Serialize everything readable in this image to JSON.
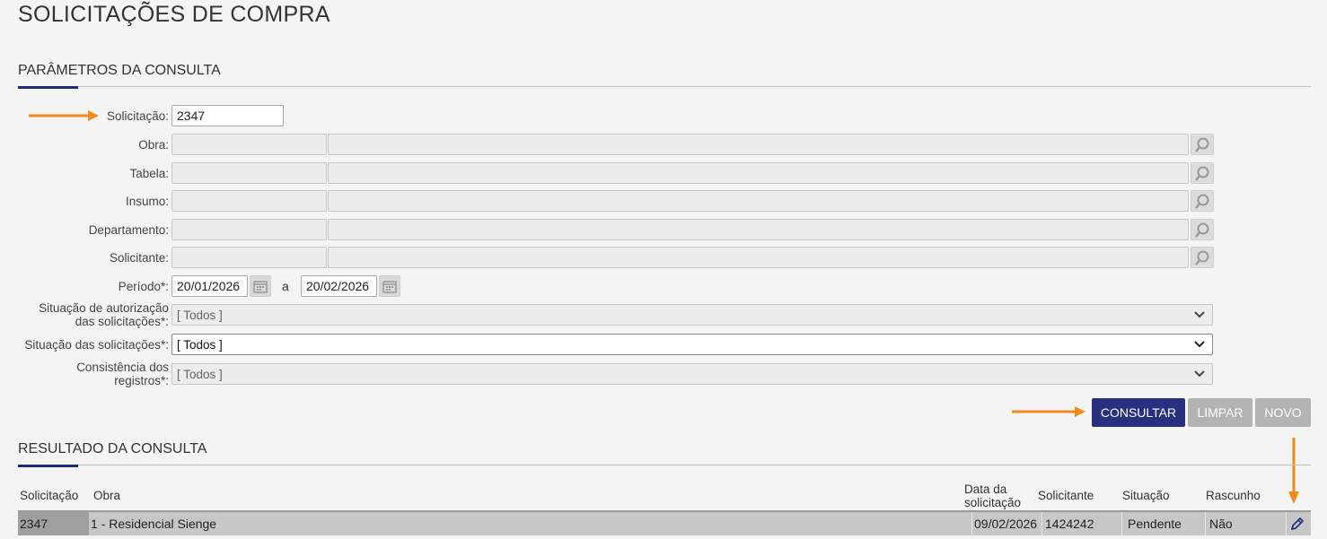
{
  "page": {
    "title": "SOLICITAÇÕES DE COMPRA"
  },
  "params": {
    "section_title": "PARÂMETROS DA CONSULTA",
    "solicitacao": {
      "label": "Solicitação:",
      "value": "2347"
    },
    "obra": {
      "label": "Obra:"
    },
    "tabela": {
      "label": "Tabela:"
    },
    "insumo": {
      "label": "Insumo:"
    },
    "departamento": {
      "label": "Departamento:"
    },
    "solicitante": {
      "label": "Solicitante:"
    },
    "periodo": {
      "label": "Período*:",
      "start": "20/01/2026",
      "separator": "a",
      "end": "20/02/2026"
    },
    "situacao_autorizacao": {
      "label_line1": "Situação de autorização",
      "label_line2": "das solicitações*:",
      "value": "[ Todos ]"
    },
    "situacao_solicitacoes": {
      "label": "Situação das solicitações*:",
      "value": "[ Todos ]"
    },
    "consistencia": {
      "label_line1": "Consistência dos",
      "label_line2": "registros*:",
      "value": "[ Todos ]"
    }
  },
  "actions": {
    "consultar": "CONSULTAR",
    "limpar": "LIMPAR",
    "novo": "NOVO"
  },
  "results": {
    "section_title": "RESULTADO DA CONSULTA",
    "columns": {
      "solicitacao": "Solicitação",
      "obra": "Obra",
      "data_line1": "Data da",
      "data_line2": "solicitação",
      "solicitante": "Solicitante",
      "situacao": "Situação",
      "rascunho": "Rascunho"
    },
    "rows": [
      {
        "solicitacao": "2347",
        "obra": "1 - Residencial Sienge",
        "data": "09/02/2026",
        "solicitante": "1424242",
        "situacao": "Pendente",
        "rascunho": "Não"
      }
    ]
  },
  "icons": {
    "search": "magnifier-icon",
    "calendar": "calendar-icon",
    "dropdown": "chevron-down-icon",
    "edit": "pencil-icon",
    "annotation": "orange-arrow"
  },
  "colors": {
    "primary": "#28307f",
    "disabled": "#b3b3b3",
    "annotation": "#f28a1e",
    "accent": "#23297a"
  }
}
